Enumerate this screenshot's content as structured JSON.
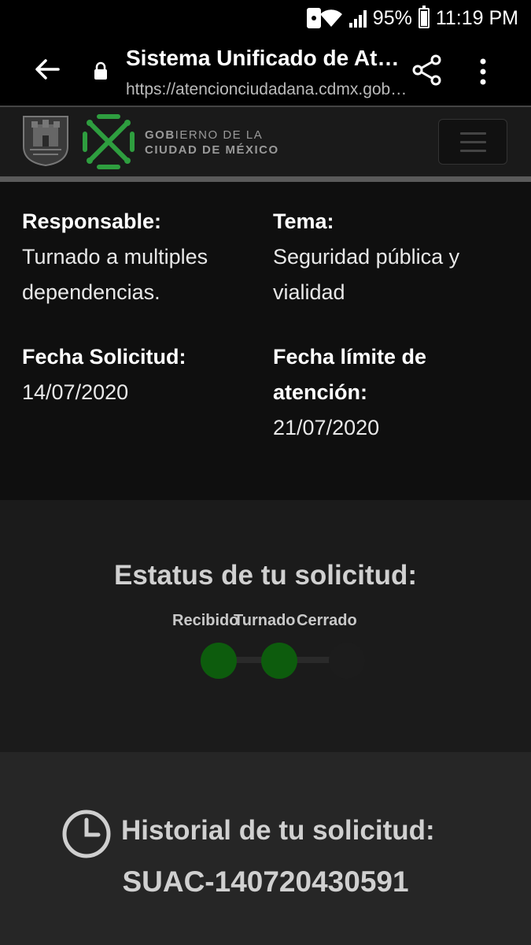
{
  "status_bar": {
    "battery": "95%",
    "time": "11:19 PM"
  },
  "browser": {
    "page_title": "Sistema Unificado de Atención Ciudadana",
    "url": "https://atencionciudadana.cdmx.gob.mx"
  },
  "site_header": {
    "gov_line1_bold": "GOB",
    "gov_line1_rest": "IERNO DE LA",
    "gov_line2": "CIUDAD DE MÉXICO",
    "brand_green": "#2e9e3f"
  },
  "details": {
    "responsable_label": "Responsable:",
    "responsable_value_1": "Turnado a multiples",
    "responsable_value_2": "dependencias.",
    "tema_label": "Tema:",
    "tema_value_1": "Seguridad pública y",
    "tema_value_2": "vialidad",
    "fecha_solicitud_label": "Fecha Solicitud:",
    "fecha_solicitud_value": "14/07/2020",
    "fecha_limite_label_1": "Fecha límite de",
    "fecha_limite_label_2": "atención:",
    "fecha_limite_value": "21/07/2020"
  },
  "status": {
    "title": "Estatus de tu solicitud:",
    "steps": [
      {
        "label": "Recibido",
        "state": "complete"
      },
      {
        "label": "Turnado",
        "state": "complete"
      },
      {
        "label": "Cerrado",
        "state": "pending"
      }
    ],
    "complete_color": "#0d5c0d",
    "pending_color": "#1c1c1c"
  },
  "history": {
    "title": "Historial de tu solicitud:",
    "request_id": "SUAC-140720430591"
  }
}
